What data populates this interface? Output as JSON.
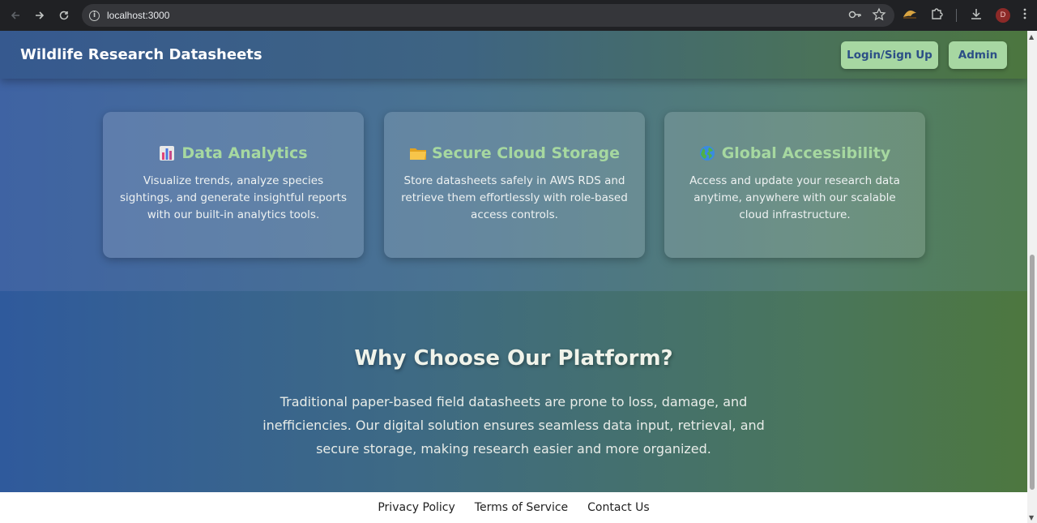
{
  "browser": {
    "url": "localhost:3000",
    "profile_initial": "D",
    "icons": [
      "back-icon",
      "forward-icon",
      "reload-icon",
      "site-info-icon",
      "password-key-icon",
      "bookmark-star-icon",
      "extension-icon",
      "puzzle-icon",
      "download-icon",
      "menu-kebab-icon"
    ]
  },
  "header": {
    "brand": "Wildlife Research Datasheets",
    "login_label": "Login/Sign Up",
    "admin_label": "Admin"
  },
  "features": [
    {
      "icon": "bar-chart-icon",
      "title": "Data Analytics",
      "description": "Visualize trends, analyze species sightings, and generate insightful reports with our built-in analytics tools."
    },
    {
      "icon": "folder-icon",
      "title": "Secure Cloud Storage",
      "description": "Store datasheets safely in AWS RDS and retrieve them effortlessly with role-based access controls."
    },
    {
      "icon": "globe-icon",
      "title": "Global Accessibility",
      "description": "Access and update your research data anytime, anywhere with our scalable cloud infrastructure."
    }
  ],
  "why": {
    "title": "Why Choose Our Platform?",
    "body": "Traditional paper-based field datasheets are prone to loss, damage, and inefficiencies. Our digital solution ensures seamless data input, retrieval, and secure storage, making research easier and more organized."
  },
  "footer": {
    "links": [
      "Privacy Policy",
      "Terms of Service",
      "Contact Us"
    ]
  },
  "colors": {
    "accent_green": "#a7d7a2",
    "button_text_blue": "#2c4f86",
    "card_title_green": "#a6d8a0"
  }
}
